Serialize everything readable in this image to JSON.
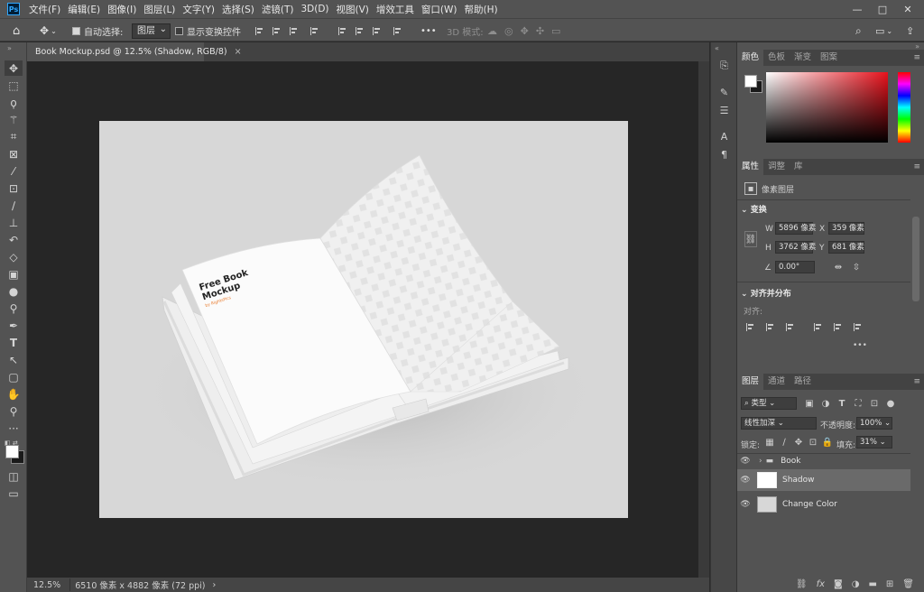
{
  "menubar": {
    "logo": "Ps",
    "items": [
      "文件(F)",
      "编辑(E)",
      "图像(I)",
      "图层(L)",
      "文字(Y)",
      "选择(S)",
      "滤镜(T)",
      "3D(D)",
      "视图(V)",
      "增效工具",
      "窗口(W)",
      "帮助(H)"
    ],
    "window_controls": [
      "—",
      "□",
      "✕"
    ]
  },
  "options": {
    "auto_select_label": "自动选择:",
    "auto_select_checked": true,
    "auto_select_target": "图层",
    "show_transform_label": "显示变换控件",
    "more": "•••",
    "mode_3d_label": "3D 模式:"
  },
  "document": {
    "tab_title": "Book Mockup.psd @ 12.5% (Shadow, RGB/8)",
    "tab_close": "×"
  },
  "artwork": {
    "book_title_line1": "Free Book",
    "book_title_line2": "Mockup",
    "book_byline": "by RightsPics"
  },
  "status": {
    "zoom": "12.5%",
    "doc_info": "6510 像素 x 4882 像素 (72 ppi)",
    "arrow": "›"
  },
  "color_panel": {
    "tabs": [
      "颜色",
      "色板",
      "渐变",
      "图案"
    ],
    "active_tab": 0,
    "foreground": "#ffffff",
    "background": "#1a1a1a",
    "hue_color": "#e8121c"
  },
  "properties_panel": {
    "tabs": [
      "属性",
      "调整",
      "库"
    ],
    "active_tab": 0,
    "kind_label": "像素图层",
    "transform": {
      "title": "变换",
      "w_label": "W",
      "w_value": "5896 像素",
      "h_label": "H",
      "h_value": "3762 像素",
      "x_label": "X",
      "x_value": "359 像素",
      "y_label": "Y",
      "y_value": "681 像素",
      "angle_value": "0.00°"
    },
    "align": {
      "title": "对齐并分布",
      "subtitle": "对齐:",
      "more": "•••"
    }
  },
  "layers_panel": {
    "tabs": [
      "图层",
      "通道",
      "路径"
    ],
    "active_tab": 0,
    "filter_kind": "类型",
    "blend_mode": "线性加深",
    "opacity_label": "不透明度:",
    "opacity_value": "100%",
    "lock_label": "锁定:",
    "fill_label": "填充:",
    "fill_value": "31%",
    "layers": [
      {
        "name": "Book",
        "type": "group",
        "visible": true,
        "selected": false
      },
      {
        "name": "Shadow",
        "type": "pixel",
        "visible": true,
        "selected": true
      },
      {
        "name": "Change Color",
        "type": "pixel",
        "visible": true,
        "selected": false
      }
    ],
    "bottom_icons": [
      "link-icon",
      "fx-icon",
      "mask-icon",
      "adjustment-icon",
      "group-icon",
      "new-layer-icon",
      "trash-icon"
    ]
  }
}
